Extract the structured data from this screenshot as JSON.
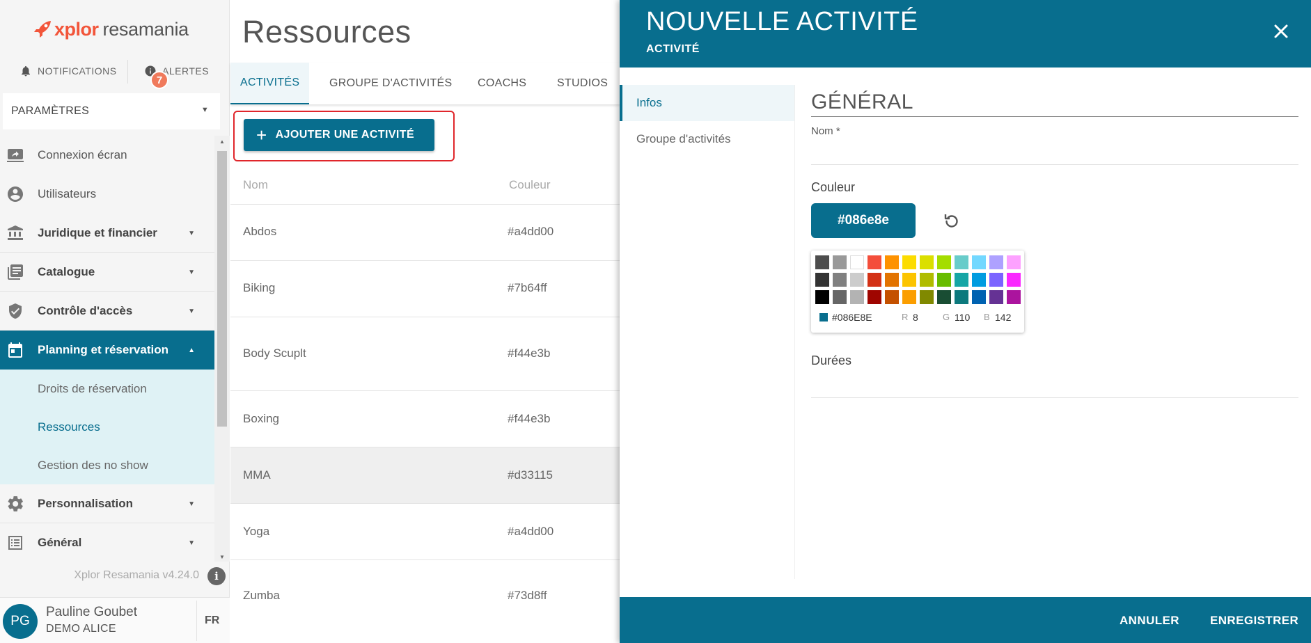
{
  "brand": {
    "name_part1": "xplor",
    "name_part2": "resamania",
    "accent": "#f2553a"
  },
  "topbar": {
    "notifications_label": "NOTIFICATIONS",
    "alerts_label": "ALERTES",
    "alerts_count": "7"
  },
  "params_select": {
    "label": "PARAMÈTRES"
  },
  "sidebar": {
    "items": [
      {
        "label": "Connexion écran",
        "icon": "screen-share-icon"
      },
      {
        "label": "Utilisateurs",
        "icon": "user-circle-icon"
      },
      {
        "label": "Juridique et financier",
        "icon": "bank-icon"
      },
      {
        "label": "Catalogue",
        "icon": "catalog-icon"
      },
      {
        "label": "Contrôle d'accès",
        "icon": "shield-check-icon"
      },
      {
        "label": "Planning et réservation",
        "icon": "calendar-icon"
      },
      {
        "label": "Personnalisation",
        "icon": "gear-icon"
      },
      {
        "label": "Général",
        "icon": "list-icon"
      }
    ],
    "submenu": [
      "Droits de réservation",
      "Ressources",
      "Gestion des no show"
    ]
  },
  "version": "Xplor Resamania v4.24.0",
  "user": {
    "initials": "PG",
    "name": "Pauline Goubet",
    "org": "DEMO ALICE",
    "lang": "FR"
  },
  "page": {
    "title": "Ressources",
    "tabs": [
      "ACTIVITÉS",
      "GROUPE D'ACTIVITÉS",
      "COACHS",
      "STUDIOS"
    ],
    "add_button": "AJOUTER UNE ACTIVITÉ",
    "columns": [
      "Nom",
      "Couleur"
    ],
    "rows": [
      {
        "name": "Abdos",
        "color": "#a4dd00"
      },
      {
        "name": "Biking",
        "color": "#7b64ff"
      },
      {
        "name": "Body Scuplt",
        "color": "#f44e3b"
      },
      {
        "name": "Boxing",
        "color": "#f44e3b"
      },
      {
        "name": "MMA",
        "color": "#d33115"
      },
      {
        "name": "Yoga",
        "color": "#a4dd00"
      },
      {
        "name": "Zumba",
        "color": "#73d8ff"
      }
    ]
  },
  "drawer": {
    "title": "NOUVELLE ACTIVITÉ",
    "subtitle": "ACTIVITÉ",
    "nav": [
      "Infos",
      "Groupe d'activités"
    ],
    "section": "GÉNÉRAL",
    "name_label": "Nom *",
    "color_label": "Couleur",
    "color_value": "#086e8e",
    "durations_label": "Durées",
    "picker": {
      "hex": "#086E8E",
      "r_label": "R",
      "r": "8",
      "g_label": "G",
      "g": "110",
      "b_label": "B",
      "b": "142",
      "swatches": [
        "#4d4d4d",
        "#999999",
        "#ffffff",
        "#f44e3b",
        "#fe9200",
        "#fcdc00",
        "#dbdf00",
        "#a4dd00",
        "#68ccca",
        "#73d8ff",
        "#aea1ff",
        "#fda1ff",
        "#333333",
        "#808080",
        "#cccccc",
        "#d33115",
        "#e27300",
        "#fcc400",
        "#b0bc00",
        "#68bc00",
        "#16a5a5",
        "#009ce0",
        "#7b64ff",
        "#fa28ff",
        "#000000",
        "#666666",
        "#b3b3b3",
        "#9f0500",
        "#c45100",
        "#fb9e00",
        "#808900",
        "#194d33",
        "#0c797d",
        "#0062b1",
        "#653294",
        "#ab149e"
      ]
    },
    "cancel": "ANNULER",
    "save": "ENREGISTRER"
  }
}
